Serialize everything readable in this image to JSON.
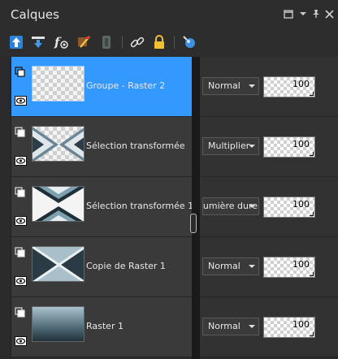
{
  "panel": {
    "title": "Calques"
  },
  "window_icons": [
    "restore-icon",
    "menu-arrow-icon",
    "pin-icon",
    "close-icon"
  ],
  "toolbar_icons": [
    "new-raster-layer-icon",
    "new-vector-layer-icon",
    "layer-visibility-icon",
    "edit-selection-icon",
    "layer-group-icon",
    "link-icon",
    "lock-icon",
    "layer-properties-icon"
  ],
  "colors": {
    "selected": "#3399ff",
    "panel_bg": "#2b2b2b",
    "row_bg": "#3a3a3a"
  },
  "layers": [
    {
      "name": "Groupe - Raster 2",
      "blend_mode": "Normal",
      "opacity": "100",
      "selected": true
    },
    {
      "name": "Sélection transformée",
      "blend_mode": "Multiplier",
      "opacity": "100",
      "selected": false
    },
    {
      "name": "Sélection transformée 1",
      "blend_mode": "Lumière dure",
      "opacity": "100",
      "selected": false
    },
    {
      "name": "Copie de Raster 1",
      "blend_mode": "Normal",
      "opacity": "100",
      "selected": false
    },
    {
      "name": "Raster 1",
      "blend_mode": "Normal",
      "opacity": "100",
      "selected": false
    }
  ]
}
